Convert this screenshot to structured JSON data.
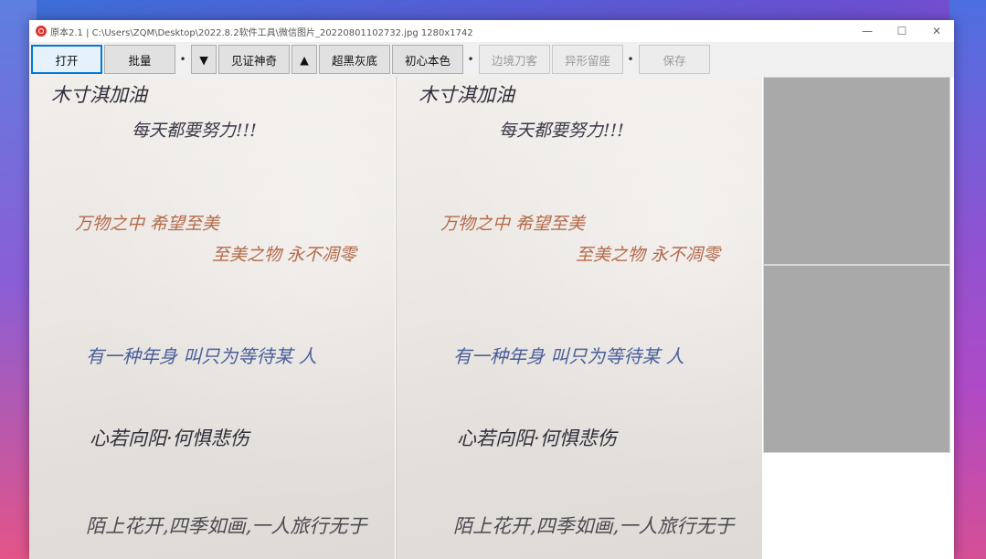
{
  "window": {
    "title": "原本2.1 | C:\\Users\\ZQM\\Desktop\\2022.8.2软件工具\\微信图片_20220801102732.jpg 1280x1742",
    "controls": {
      "minimize": "—",
      "maximize": "☐",
      "close": "✕"
    }
  },
  "toolbar": {
    "open": "打开",
    "batch": "批量",
    "dot": "•",
    "down_arrow": "▼",
    "witness": "见证神奇",
    "up_arrow": "▲",
    "super_black": "超黑灰底",
    "original_color": "初心本色",
    "edge_cutter": "边境刀客",
    "odd_seat": "异形留座",
    "save": "保存"
  },
  "document": {
    "lines": [
      {
        "text": "木寸淇加油",
        "color": "#2f2f3a"
      },
      {
        "text": "每天都要努力!!!",
        "color": "#3a3a46"
      },
      {
        "text": "万物之中 希望至美",
        "color": "#b46a4a"
      },
      {
        "text": "至美之物 永不凋零",
        "color": "#b46a4a"
      },
      {
        "text": "有一种年身 叫只为等待某 人",
        "color": "#4a5f9a"
      },
      {
        "text": "心若向阳·何惧悲伤",
        "color": "#2f2f3a"
      },
      {
        "text": "陌上花开,四季如画,一人旅行无于",
        "color": "#4a4a50"
      }
    ]
  },
  "colors": {
    "accent": "#0078d7",
    "thumbnail": "#a9a9a9"
  },
  "icons": {
    "app": "app-logo-icon"
  }
}
